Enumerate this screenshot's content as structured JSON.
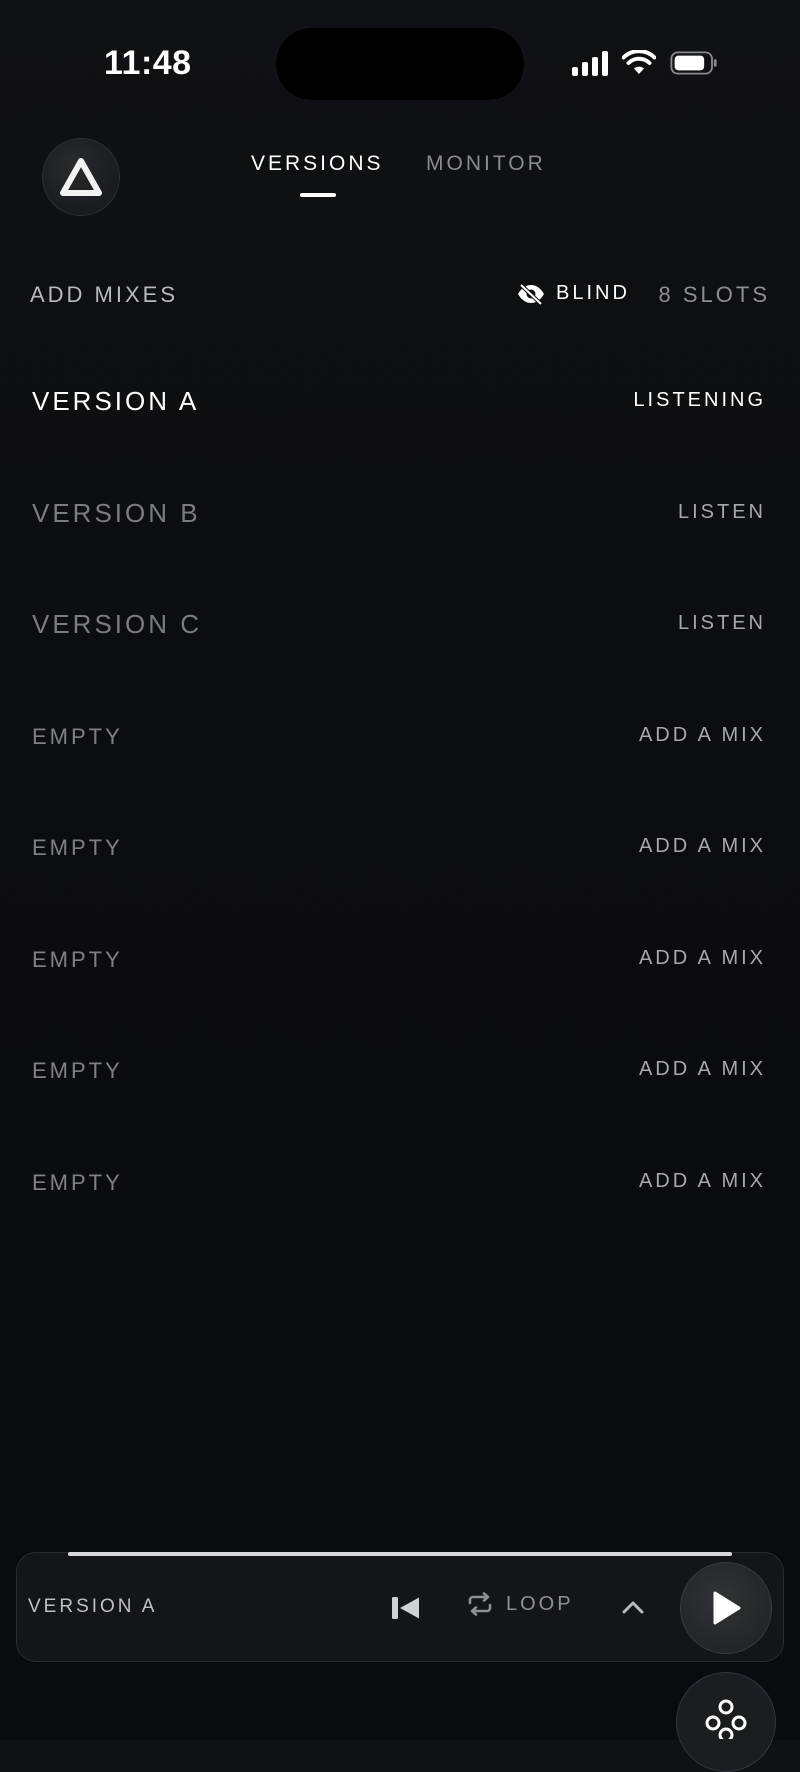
{
  "status_bar": {
    "time": "11:48"
  },
  "nav": {
    "tabs": [
      {
        "label": "VERSIONS",
        "active": true
      },
      {
        "label": "MONITOR",
        "active": false
      }
    ]
  },
  "toolbar": {
    "add_mixes_label": "ADD MIXES",
    "blind_label": "BLIND",
    "slots_label": "8 SLOTS"
  },
  "slots": [
    {
      "name": "VERSION A",
      "action": "LISTENING"
    },
    {
      "name": "VERSION B",
      "action": "LISTEN"
    },
    {
      "name": "VERSION C",
      "action": "LISTEN"
    },
    {
      "name": "EMPTY",
      "action": "ADD A MIX"
    },
    {
      "name": "EMPTY",
      "action": "ADD A MIX"
    },
    {
      "name": "EMPTY",
      "action": "ADD A MIX"
    },
    {
      "name": "EMPTY",
      "action": "ADD A MIX"
    },
    {
      "name": "EMPTY",
      "action": "ADD A MIX"
    }
  ],
  "player": {
    "title": "VERSION A",
    "loop_label": "LOOP",
    "progress": 1.0
  },
  "icons": {
    "logo": "triangle-logo-icon",
    "blind": "eye-slash-icon",
    "prev": "skip-back-icon",
    "loop": "repeat-icon",
    "expand": "chevron-up-icon",
    "play": "play-icon",
    "fab": "nodes-icon"
  },
  "colors": {
    "background": "#0c0d10",
    "text_primary": "#ffffff",
    "text_muted": "#8a8b8f"
  }
}
